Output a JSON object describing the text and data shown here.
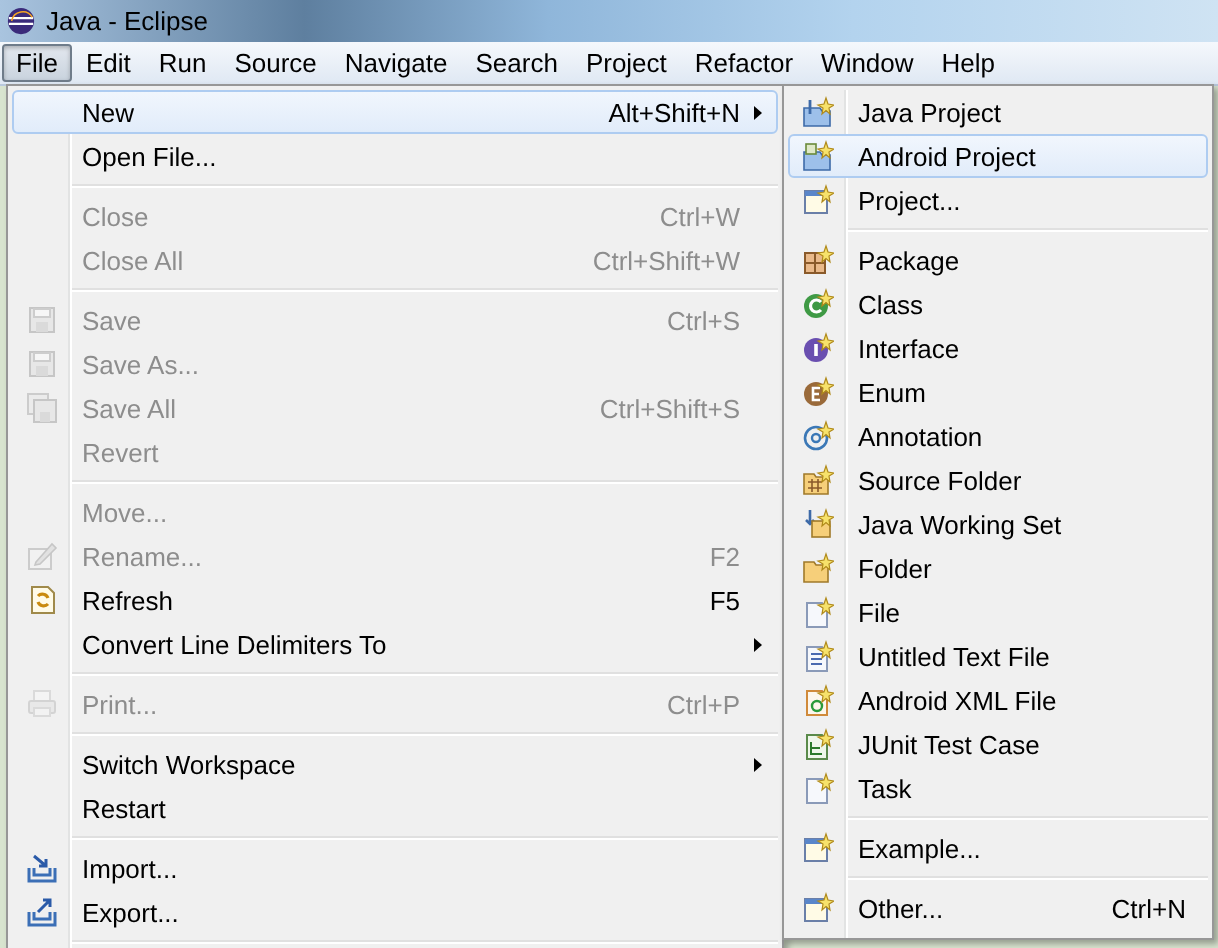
{
  "window": {
    "title": "Java - Eclipse"
  },
  "menubar": [
    {
      "label": "File",
      "selected": true
    },
    {
      "label": "Edit",
      "selected": false
    },
    {
      "label": "Run",
      "selected": false
    },
    {
      "label": "Source",
      "selected": false
    },
    {
      "label": "Navigate",
      "selected": false
    },
    {
      "label": "Search",
      "selected": false
    },
    {
      "label": "Project",
      "selected": false
    },
    {
      "label": "Refactor",
      "selected": false
    },
    {
      "label": "Window",
      "selected": false
    },
    {
      "label": "Help",
      "selected": false
    }
  ],
  "file_menu": {
    "items": [
      {
        "kind": "item",
        "label": "New",
        "shortcut": "Alt+Shift+N",
        "submenu": true,
        "disabled": false,
        "selected": true
      },
      {
        "kind": "item",
        "label": "Open File...",
        "submenu": false,
        "disabled": false,
        "selected": false
      },
      {
        "kind": "separator"
      },
      {
        "kind": "item",
        "label": "Close",
        "shortcut": "Ctrl+W",
        "submenu": false,
        "disabled": true,
        "selected": false
      },
      {
        "kind": "item",
        "label": "Close All",
        "shortcut": "Ctrl+Shift+W",
        "submenu": false,
        "disabled": true,
        "selected": false
      },
      {
        "kind": "separator"
      },
      {
        "kind": "item",
        "label": "Save",
        "shortcut": "Ctrl+S",
        "submenu": false,
        "disabled": true,
        "selected": false
      },
      {
        "kind": "item",
        "label": "Save As...",
        "submenu": false,
        "disabled": true,
        "selected": false
      },
      {
        "kind": "item",
        "label": "Save All",
        "shortcut": "Ctrl+Shift+S",
        "submenu": false,
        "disabled": true,
        "selected": false
      },
      {
        "kind": "item",
        "label": "Revert",
        "submenu": false,
        "disabled": true,
        "selected": false
      },
      {
        "kind": "separator"
      },
      {
        "kind": "item",
        "label": "Move...",
        "submenu": false,
        "disabled": true,
        "selected": false
      },
      {
        "kind": "item",
        "label": "Rename...",
        "shortcut": "F2",
        "submenu": false,
        "disabled": true,
        "selected": false
      },
      {
        "kind": "item",
        "label": "Refresh",
        "shortcut": "F5",
        "submenu": false,
        "disabled": false,
        "selected": false
      },
      {
        "kind": "item",
        "label": "Convert Line Delimiters To",
        "submenu": true,
        "disabled": false,
        "selected": false
      },
      {
        "kind": "separator"
      },
      {
        "kind": "item",
        "label": "Print...",
        "shortcut": "Ctrl+P",
        "submenu": false,
        "disabled": true,
        "selected": false
      },
      {
        "kind": "separator"
      },
      {
        "kind": "item",
        "label": "Switch Workspace",
        "submenu": true,
        "disabled": false,
        "selected": false
      },
      {
        "kind": "item",
        "label": "Restart",
        "submenu": false,
        "disabled": false,
        "selected": false
      },
      {
        "kind": "separator"
      },
      {
        "kind": "item",
        "label": "Import...",
        "submenu": false,
        "disabled": false,
        "selected": false
      },
      {
        "kind": "item",
        "label": "Export...",
        "submenu": false,
        "disabled": false,
        "selected": false
      },
      {
        "kind": "separator"
      }
    ]
  },
  "new_submenu": {
    "items": [
      {
        "kind": "item",
        "label": "Java Project",
        "selected": false
      },
      {
        "kind": "item",
        "label": "Android Project",
        "selected": true
      },
      {
        "kind": "item",
        "label": "Project...",
        "selected": false
      },
      {
        "kind": "separator"
      },
      {
        "kind": "item",
        "label": "Package",
        "selected": false
      },
      {
        "kind": "item",
        "label": "Class",
        "selected": false
      },
      {
        "kind": "item",
        "label": "Interface",
        "selected": false
      },
      {
        "kind": "item",
        "label": "Enum",
        "selected": false
      },
      {
        "kind": "item",
        "label": "Annotation",
        "selected": false
      },
      {
        "kind": "item",
        "label": "Source Folder",
        "selected": false
      },
      {
        "kind": "item",
        "label": "Java Working Set",
        "selected": false
      },
      {
        "kind": "item",
        "label": "Folder",
        "selected": false
      },
      {
        "kind": "item",
        "label": "File",
        "selected": false
      },
      {
        "kind": "item",
        "label": "Untitled Text File",
        "selected": false
      },
      {
        "kind": "item",
        "label": "Android XML File",
        "selected": false
      },
      {
        "kind": "item",
        "label": "JUnit Test Case",
        "selected": false
      },
      {
        "kind": "item",
        "label": "Task",
        "selected": false
      },
      {
        "kind": "separator"
      },
      {
        "kind": "item",
        "label": "Example...",
        "selected": false
      },
      {
        "kind": "separator"
      },
      {
        "kind": "item",
        "label": "Other...",
        "shortcut": "Ctrl+N",
        "selected": false
      }
    ]
  }
}
